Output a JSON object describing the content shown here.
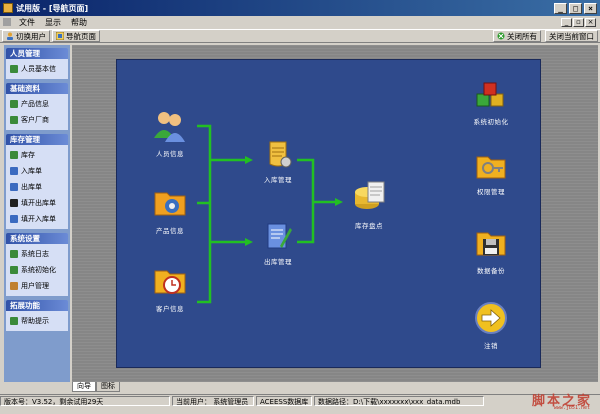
{
  "window": {
    "title": "试用版 - [导航页面]"
  },
  "menu": {
    "items": [
      "文件",
      "显示",
      "帮助"
    ]
  },
  "toolbar": {
    "switch_user": "切换用户",
    "nav_page": "导航页面",
    "close_all": "关闭所有",
    "close_current": "关闭当前窗口"
  },
  "sidebar": {
    "groups": [
      {
        "title": "人员管理",
        "items": [
          "人员基本信"
        ]
      },
      {
        "title": "基础资料",
        "items": [
          "产品信息",
          "客户厂商"
        ]
      },
      {
        "title": "库存管理",
        "items": [
          "库存",
          "入库单",
          "出库单",
          "填开出库单",
          "填开入库单"
        ]
      },
      {
        "title": "系统设置",
        "items": [
          "系统日志",
          "系统初始化",
          "用户管理"
        ]
      },
      {
        "title": "拓展功能",
        "items": [
          "帮助提示"
        ]
      }
    ]
  },
  "canvas": {
    "nodes": {
      "person": "人员信息",
      "product": "产品信息",
      "customer": "客户信息",
      "stock_in": "入库管理",
      "stock_out": "出库管理",
      "inventory": "库存盘点",
      "init": "系统初始化",
      "permission": "权限管理",
      "backup": "数据备份",
      "logout": "注销"
    }
  },
  "tabs": [
    "向导",
    "图标"
  ],
  "status": {
    "version": "版本号：V3.52，剩余试用29天",
    "current_user": "当前用户：  系统管理员",
    "db": "ACEESS数据库",
    "path": "数据路径：D:\\下载\\xxxxxxx\\xxx_data.mdb"
  },
  "colors": {
    "canvas": "#2f4a8c",
    "arrows": "#22c022",
    "nav_head": "#3152a8"
  },
  "watermark": {
    "text": "脚本之家",
    "sub": "www.jb51.net"
  }
}
